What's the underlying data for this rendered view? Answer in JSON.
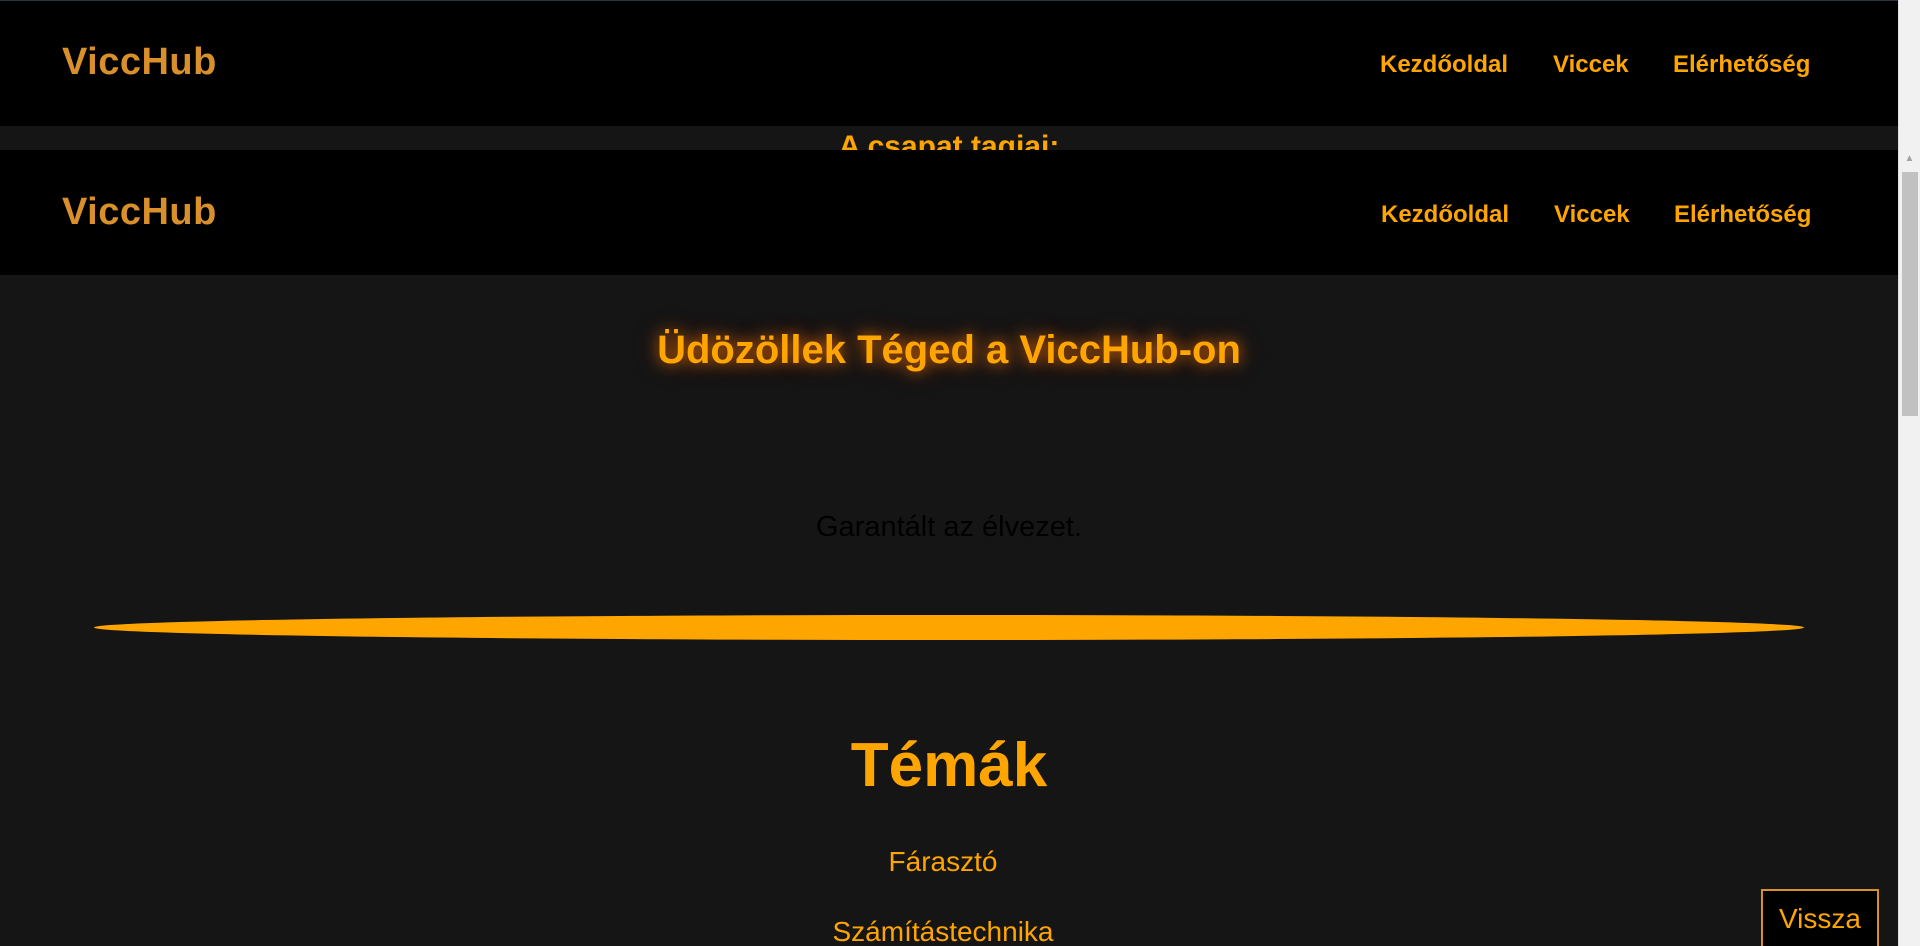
{
  "outer_header": {
    "logo": "ViccHub",
    "nav": [
      "Kezdőoldal",
      "Viccek",
      "Elérhetőség"
    ]
  },
  "team_heading": "A csapat tagjai:",
  "inner_header": {
    "logo": "ViccHub",
    "nav": [
      "Kezdőoldal",
      "Viccek",
      "Elérhetőség"
    ]
  },
  "hero": {
    "welcome": "Üdözöllek Téged a ViccHub-on",
    "tagline": "Garantált az élvezet."
  },
  "topics": {
    "heading": "Témák",
    "items": [
      "Fárasztó",
      "Számítástechnika"
    ]
  },
  "back_button": "Vissza",
  "colors": {
    "accent": "#ffa500",
    "logo": "#d9902a",
    "background": "#151515",
    "header": "#000000"
  }
}
